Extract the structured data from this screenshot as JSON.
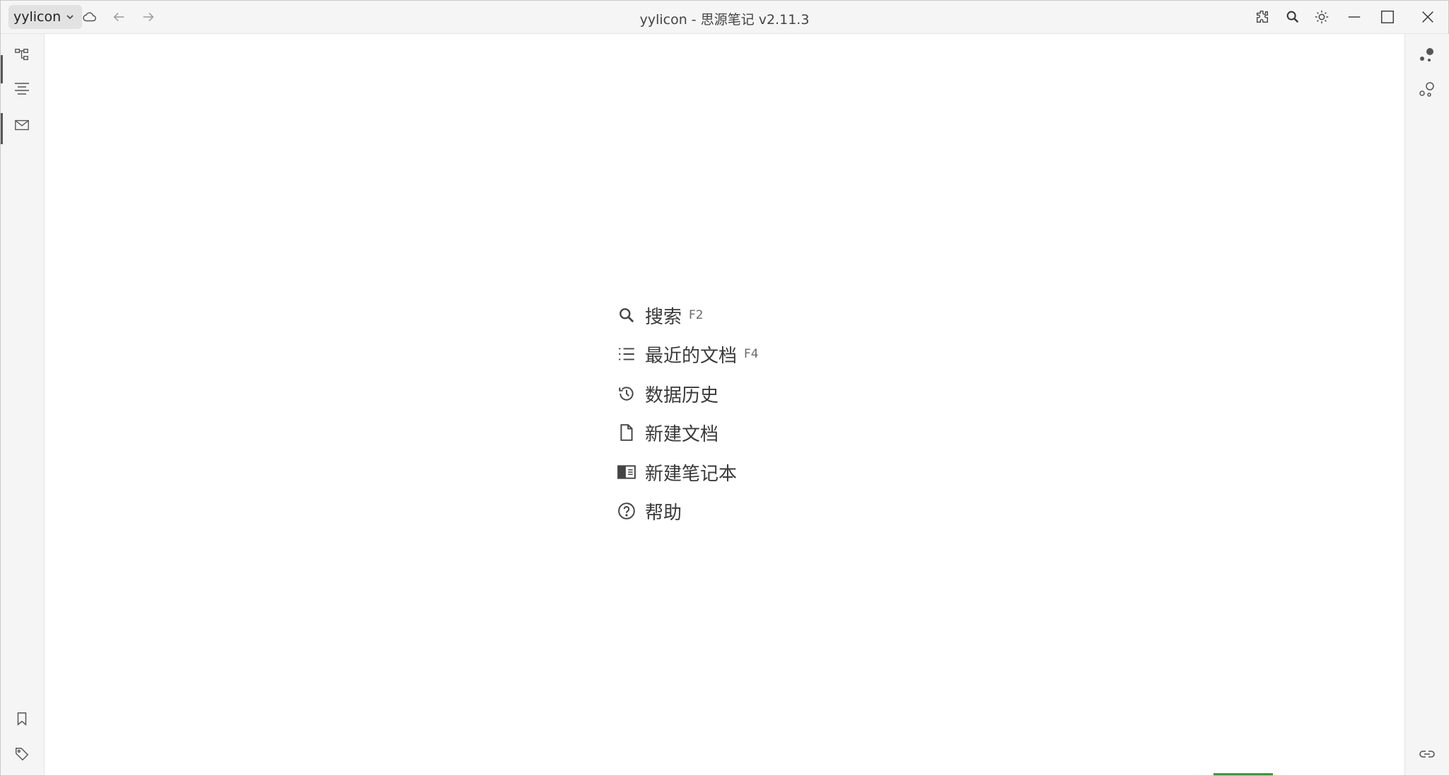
{
  "titlebar": {
    "workspace_name": "yylicon",
    "window_title": "yylicon - 思源笔记 v2.11.3",
    "icons": [
      "chevron-down-icon",
      "cloud-icon",
      "back-arrow-icon",
      "forward-arrow-icon",
      "plugin-icon",
      "search-icon",
      "theme-sun-icon",
      "minimize-icon",
      "maximize-icon",
      "close-icon"
    ]
  },
  "left_dock": {
    "top_icons": [
      "file-tree-icon",
      "outline-icon",
      "inbox-icon"
    ],
    "bottom_icons": [
      "bookmark-icon",
      "tag-icon"
    ]
  },
  "right_dock": {
    "top_icons": [
      "graph-view-icon",
      "global-graph-icon"
    ],
    "bottom_icons": [
      "backlink-icon"
    ]
  },
  "empty_menu": {
    "items": [
      {
        "icon": "search-icon",
        "label": "搜索",
        "key": "F2"
      },
      {
        "icon": "list-icon",
        "label": "最近的文档",
        "key": "F4"
      },
      {
        "icon": "history-icon",
        "label": "数据历史",
        "key": ""
      },
      {
        "icon": "file-icon",
        "label": "新建文档",
        "key": ""
      },
      {
        "icon": "notebook-icon",
        "label": "新建笔记本",
        "key": ""
      },
      {
        "icon": "help-icon",
        "label": "帮助",
        "key": ""
      }
    ]
  },
  "colors": {
    "titlebar_bg": "#f5f5f5",
    "dock_bg": "#f5f5f5",
    "workspace_btn_bg": "#e2e2e2",
    "icon": "#5f6368",
    "text": "#3a3a3a"
  }
}
